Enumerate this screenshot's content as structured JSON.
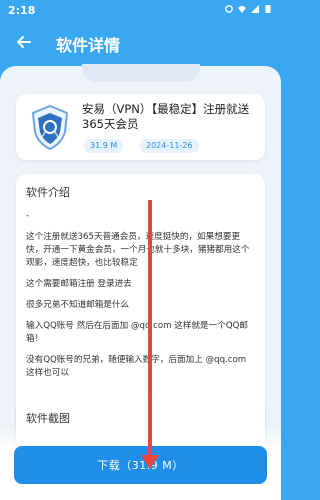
{
  "status": {
    "time": "2:18"
  },
  "header": {
    "title": "软件详情"
  },
  "app": {
    "name": "安易（VPN）【最稳定】注册就送365天会员",
    "size": "31.9 M",
    "date": "2024-11-26"
  },
  "intro": {
    "title": "软件介绍",
    "lines": [
      "-",
      "这个注册就送365天普通会员，速度挺快的，如果想要更快，开通一下黄金会员，一个月也就十多块，猪猪都用这个观影，速度超快，也比较稳定",
      "这个需要邮箱注册 登录进去",
      "很多兄弟不知道邮箱是什么",
      "输入QQ账号 然后在后面加 @qq.com 这样就是一个QQ邮箱！",
      "没有QQ账号的兄弟，随便输入数字，后面加上 @qq.com 这样也可以"
    ]
  },
  "screenshots": {
    "title": "软件截图"
  },
  "download": {
    "label": "下载（31.9 M）"
  },
  "colors": {
    "primary": "#1f8ee8",
    "header": "#3aa7f2",
    "annotation": "#e8483b"
  }
}
